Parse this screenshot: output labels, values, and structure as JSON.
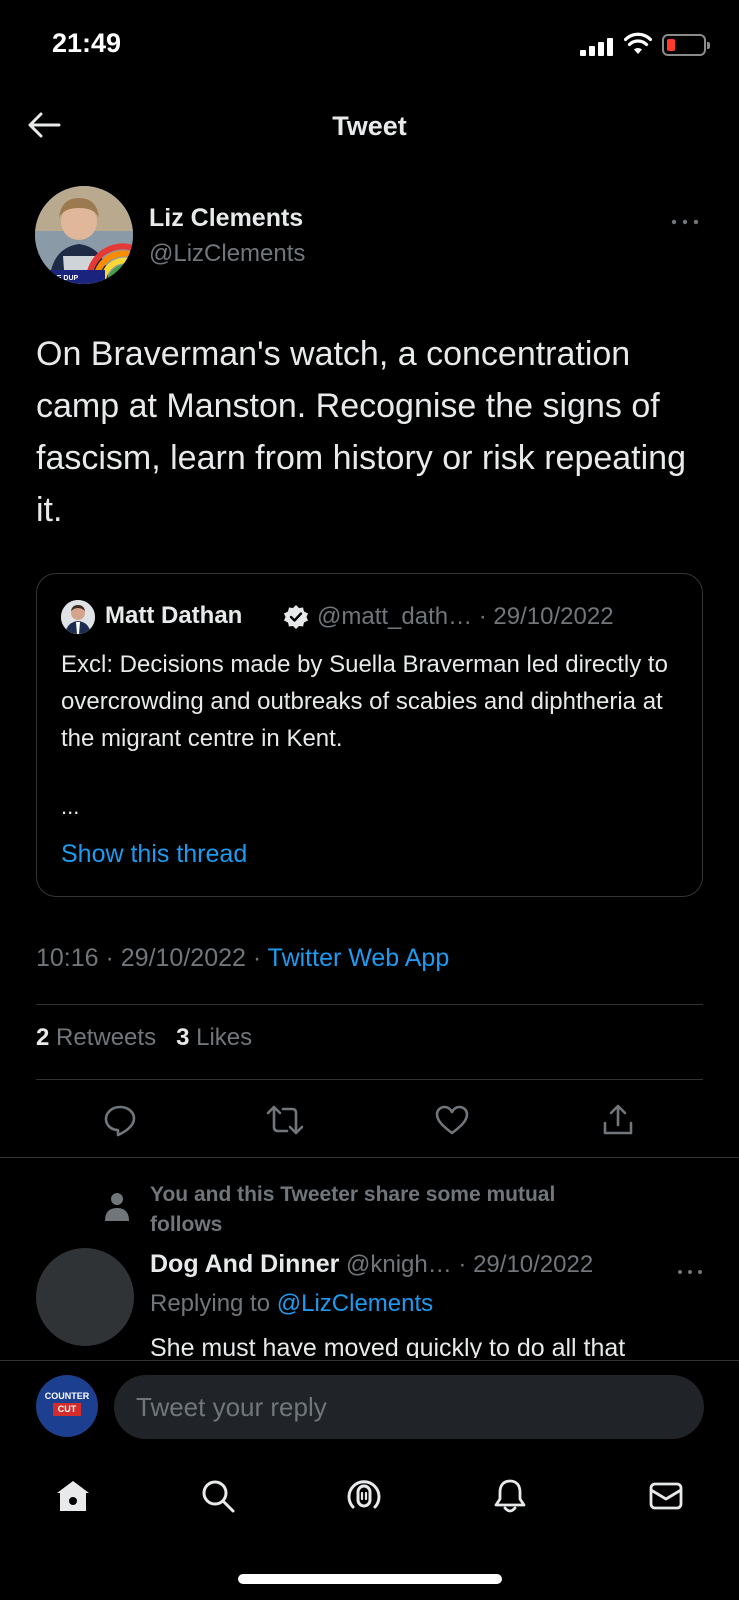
{
  "status_bar": {
    "time": "21:49"
  },
  "header": {
    "title": "Tweet"
  },
  "tweet": {
    "author_name": "Liz Clements",
    "author_handle": "@LizClements",
    "text": "On Braverman's watch, a concentration camp at Manston. Recognise the signs of fascism, learn from history or risk repeating it.",
    "quoted": {
      "author_name": "Matt Dathan",
      "meta": "@matt_dath… · 29/10/2022",
      "text": "Excl: Decisions made by Suella Braverman led directly to overcrowding and outbreaks of scabies and diphtheria at the migrant centre in Kent.",
      "ellipsis": "...",
      "show_thread": "Show this thread"
    },
    "time": "10:16 · 29/10/2022 · ",
    "source": "Twitter Web App",
    "retweets_count": "2",
    "retweets_label": " Retweets",
    "likes_count": "3",
    "likes_label": " Likes"
  },
  "mutual_notice": "You and this Tweeter share some mutual follows",
  "reply": {
    "author_name": "Dog And Dinner",
    "meta": " @knigh… · 29/10/2022",
    "replying_prefix": "Replying to ",
    "replying_to": "@LizClements",
    "text": "She must have moved quickly to do all that"
  },
  "composer": {
    "avatar_line1": "COUNTER",
    "avatar_line2": "CUT",
    "placeholder": "Tweet your reply"
  },
  "colors": {
    "background": "#000000",
    "text": "#e7e9ea",
    "muted": "#71767b",
    "accent": "#1d9bf0"
  },
  "icons": {
    "back": "arrow-left-icon",
    "more": "more-icon",
    "reply": "reply-icon",
    "retweet": "retweet-icon",
    "like": "heart-icon",
    "share": "share-icon",
    "home": "home-icon",
    "search": "search-icon",
    "spaces": "spaces-icon",
    "notifications": "bell-icon",
    "messages": "mail-icon"
  }
}
